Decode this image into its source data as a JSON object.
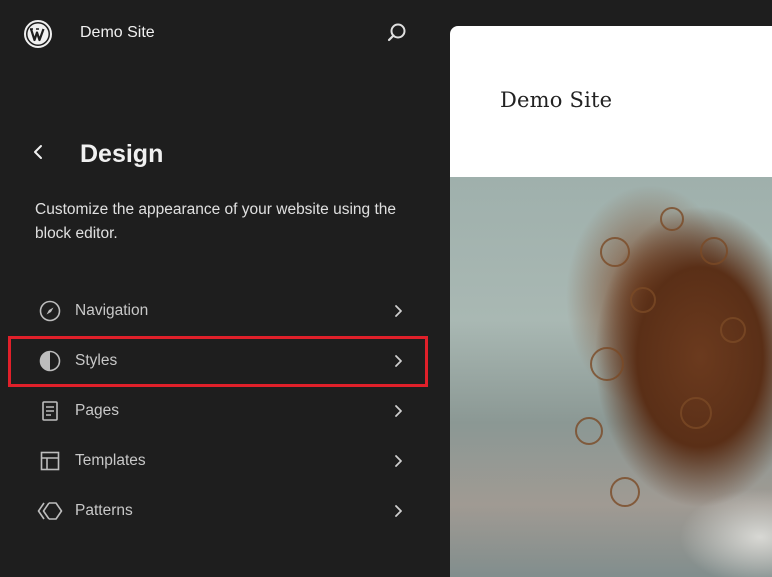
{
  "topbar": {
    "site_name": "Demo Site",
    "logo_icon": "wordpress-logo-icon",
    "search_icon": "search-icon"
  },
  "panel": {
    "back_icon": "chevron-left-icon",
    "title": "Design",
    "description": "Customize the appearance of your website using the block editor."
  },
  "menu": {
    "items": [
      {
        "label": "Navigation",
        "icon": "navigation-compass-icon"
      },
      {
        "label": "Styles",
        "icon": "styles-half-circle-icon",
        "highlighted": true
      },
      {
        "label": "Pages",
        "icon": "page-icon"
      },
      {
        "label": "Templates",
        "icon": "layout-icon"
      },
      {
        "label": "Patterns",
        "icon": "symbol-icon"
      }
    ]
  },
  "preview": {
    "site_title": "Demo Site"
  },
  "colors": {
    "background": "#1e1e1e",
    "highlight": "#e0202a",
    "preview_background": "#ffffff"
  }
}
